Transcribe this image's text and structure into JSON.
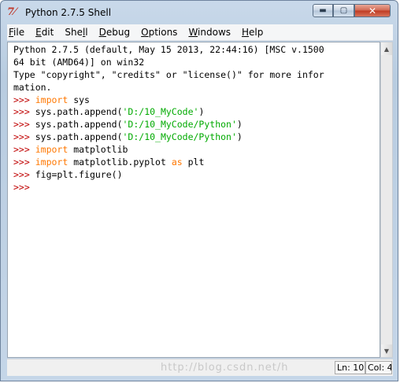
{
  "window": {
    "title": "Python 2.7.5 Shell",
    "icon": "python-idle-icon",
    "controls": {
      "minimize": "▬",
      "maximize": "▢",
      "close": "✕"
    }
  },
  "menu": {
    "items": [
      {
        "first": "F",
        "rest": "ile"
      },
      {
        "first": "E",
        "rest": "dit"
      },
      {
        "pre": "She",
        "first": "l",
        "rest": "l"
      },
      {
        "first": "D",
        "rest": "ebug"
      },
      {
        "first": "O",
        "rest": "ptions"
      },
      {
        "first": "W",
        "rest": "indows"
      },
      {
        "first": "H",
        "rest": "elp"
      }
    ]
  },
  "shell": {
    "banner": [
      "Python 2.7.5 (default, May 15 2013, 22:44:16) [MSC v.1500",
      "64 bit (AMD64)] on win32",
      "Type \"copyright\", \"credits\" or \"license()\" for more infor",
      "mation."
    ],
    "prompt": ">>>",
    "lines": [
      {
        "parts": [
          {
            "t": "import",
            "c": "kw"
          },
          {
            "t": " sys",
            "c": "plain"
          }
        ]
      },
      {
        "parts": [
          {
            "t": "sys.path.append(",
            "c": "plain"
          },
          {
            "t": "'D:/10_MyCode'",
            "c": "str"
          },
          {
            "t": ")",
            "c": "plain"
          }
        ]
      },
      {
        "parts": [
          {
            "t": "sys.path.append(",
            "c": "plain"
          },
          {
            "t": "'D:/10_MyCode/Python'",
            "c": "str"
          },
          {
            "t": ")",
            "c": "plain"
          }
        ]
      },
      {
        "parts": [
          {
            "t": "sys.path.append(",
            "c": "plain"
          },
          {
            "t": "'D:/10_MyCode/Python'",
            "c": "str"
          },
          {
            "t": ")",
            "c": "plain"
          }
        ]
      },
      {
        "parts": [
          {
            "t": "import",
            "c": "kw"
          },
          {
            "t": " matplotlib",
            "c": "plain"
          }
        ]
      },
      {
        "parts": [
          {
            "t": "import",
            "c": "kw"
          },
          {
            "t": " matplotlib.pyplot ",
            "c": "plain"
          },
          {
            "t": "as",
            "c": "kw"
          },
          {
            "t": " plt",
            "c": "plain"
          }
        ]
      },
      {
        "parts": [
          {
            "t": "fig=plt.figure()",
            "c": "plain"
          }
        ]
      },
      {
        "parts": []
      }
    ]
  },
  "status": {
    "watermark": "http://blog.csdn.net/h",
    "line": "Ln: 10",
    "col": "Col: 4"
  },
  "scrollbar": {
    "up_arrow": "▲",
    "down_arrow": "▼"
  },
  "colors": {
    "prompt": "#c00000",
    "keyword": "#ff7700",
    "string": "#00aa00"
  }
}
